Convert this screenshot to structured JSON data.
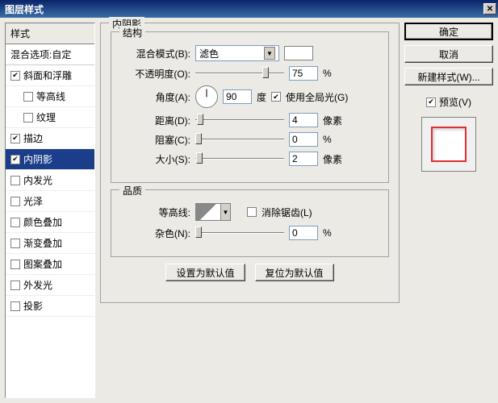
{
  "title": "图层样式",
  "left": {
    "header": "样式",
    "subheader": "混合选项:自定",
    "items": [
      {
        "label": "斜面和浮雕",
        "checked": true,
        "indent": false
      },
      {
        "label": "等高线",
        "checked": false,
        "indent": true
      },
      {
        "label": "纹理",
        "checked": false,
        "indent": true
      },
      {
        "label": "描边",
        "checked": true,
        "indent": false
      },
      {
        "label": "内阴影",
        "checked": true,
        "indent": false,
        "selected": true
      },
      {
        "label": "内发光",
        "checked": false,
        "indent": false
      },
      {
        "label": "光泽",
        "checked": false,
        "indent": false
      },
      {
        "label": "颜色叠加",
        "checked": false,
        "indent": false
      },
      {
        "label": "渐变叠加",
        "checked": false,
        "indent": false
      },
      {
        "label": "图案叠加",
        "checked": false,
        "indent": false
      },
      {
        "label": "外发光",
        "checked": false,
        "indent": false
      },
      {
        "label": "投影",
        "checked": false,
        "indent": false
      }
    ]
  },
  "center": {
    "group_title": "内阴影",
    "structure_title": "结构",
    "blend_mode_label": "混合模式(B):",
    "blend_mode_value": "滤色",
    "opacity_label": "不透明度(O):",
    "opacity_value": "75",
    "percent": "%",
    "angle_label": "角度(A):",
    "angle_value": "90",
    "angle_unit": "度",
    "global_light_label": "使用全局光(G)",
    "distance_label": "距离(D):",
    "distance_value": "4",
    "px": "像素",
    "spread_label": "阻塞(C):",
    "spread_value": "0",
    "size_label": "大小(S):",
    "size_value": "2",
    "quality_title": "品质",
    "contour_label": "等高线:",
    "antialias_label": "消除锯齿(L)",
    "noise_label": "杂色(N):",
    "noise_value": "0",
    "make_default": "设置为默认值",
    "reset_default": "复位为默认值"
  },
  "right": {
    "ok": "确定",
    "cancel": "取消",
    "new_style": "新建样式(W)...",
    "preview_label": "预览(V)"
  }
}
